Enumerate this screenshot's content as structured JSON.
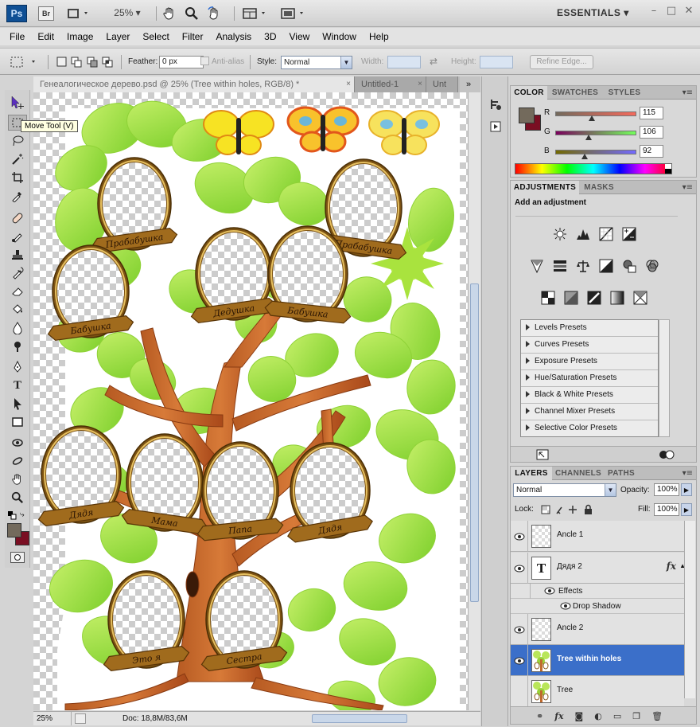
{
  "app": {
    "logo": "Ps",
    "bridge": "Br",
    "zoom": "25%",
    "workspace": "ESSENTIALS",
    "window_controls": [
      "minimize",
      "restore",
      "close"
    ]
  },
  "menu": [
    "File",
    "Edit",
    "Image",
    "Layer",
    "Select",
    "Filter",
    "Analysis",
    "3D",
    "View",
    "Window",
    "Help"
  ],
  "options": {
    "feather_label": "Feather:",
    "feather_value": "0 px",
    "antialias_label": "Anti-alias",
    "style_label": "Style:",
    "style_value": "Normal",
    "width_label": "Width:",
    "height_label": "Height:",
    "refine_edge": "Refine Edge..."
  },
  "tooltip": "Move Tool (V)",
  "documents": {
    "tabs": [
      {
        "title": "Генеалогическое дерево.psd @ 25% (Tree within holes, RGB/8) *",
        "close": "×"
      },
      {
        "title": "Untitled-1",
        "close": "×"
      },
      {
        "title": "Unt"
      }
    ],
    "overflow": "»"
  },
  "canvas": {
    "labels": {
      "f1": "Прабабушка",
      "f2": "Прабабушка",
      "f3": "Бабушка",
      "f4": "Дедушка",
      "f5": "Бабушка",
      "f6": "Дядя",
      "f7": "Мама",
      "f8": "Папа",
      "f9": "Дядя",
      "f10": "Это я",
      "f11": "Сестра"
    }
  },
  "status": {
    "zoom": "25%",
    "doc": "Doc: 18,8M/83,6M"
  },
  "color_panel": {
    "tabs": [
      "COLOR",
      "SWATCHES",
      "STYLES"
    ],
    "channels": [
      {
        "label": "R",
        "value": "115",
        "fraction": 0.451
      },
      {
        "label": "G",
        "value": "106",
        "fraction": 0.416
      },
      {
        "label": "B",
        "value": "92",
        "fraction": 0.361
      }
    ],
    "foreground": "#736a5c",
    "background": "#7a0e22"
  },
  "adjustments_panel": {
    "tabs": [
      "ADJUSTMENTS",
      "MASKS"
    ],
    "heading": "Add an adjustment",
    "presets": [
      "Levels Presets",
      "Curves Presets",
      "Exposure Presets",
      "Hue/Saturation Presets",
      "Black & White Presets",
      "Channel Mixer Presets",
      "Selective Color Presets"
    ]
  },
  "layers_panel": {
    "tabs": [
      "LAYERS",
      "CHANNELS",
      "PATHS"
    ],
    "blend_mode": "Normal",
    "opacity_label": "Opacity:",
    "opacity": "100%",
    "lock_label": "Lock:",
    "fill_label": "Fill:",
    "fill": "100%",
    "layers": [
      {
        "name": "Ancle 1"
      },
      {
        "name": "Дядя 2"
      },
      {
        "name": "Ancle 2"
      },
      {
        "name": "Tree within holes"
      },
      {
        "name": "Tree"
      }
    ],
    "effects_label": "Effects",
    "drop_shadow_label": "Drop Shadow",
    "text_thumb": "T"
  }
}
